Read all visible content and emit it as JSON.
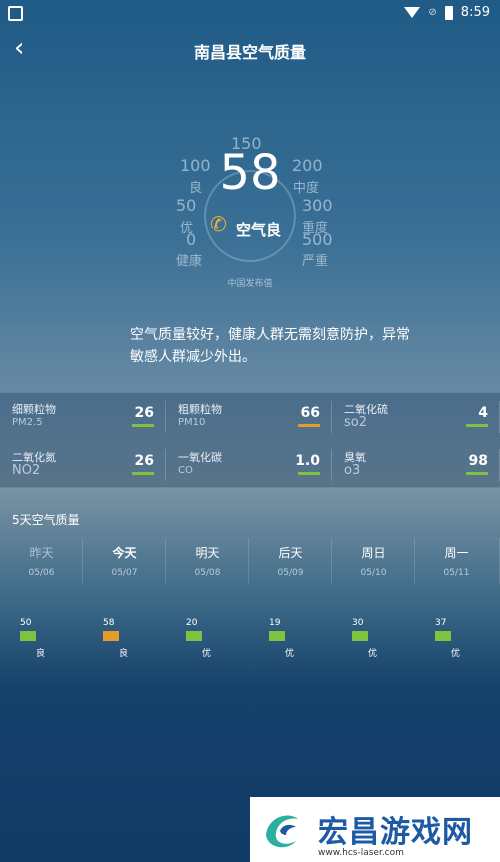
{
  "status_bar": {
    "time": "8:59"
  },
  "header": {
    "title": "南昌县空气质量",
    "back_icon": "chevron-left-icon"
  },
  "gauge": {
    "aqi": "58",
    "level": "空气良",
    "publisher": "中国发布值",
    "ticks": [
      {
        "value": "150",
        "label": ""
      },
      {
        "value": "100",
        "label": "良"
      },
      {
        "value": "200",
        "label": "中度"
      },
      {
        "value": "50",
        "label": "优"
      },
      {
        "value": "300",
        "label": "重度"
      },
      {
        "value": "0",
        "label": "健康"
      },
      {
        "value": "500",
        "label": "严重"
      }
    ]
  },
  "description": "空气质量较好，健康人群无需刻意防护，异常敏感人群减少外出。",
  "pollutants": [
    {
      "name": "细颗粒物",
      "code": "PM2.5",
      "value": "26",
      "color": "#7fc241"
    },
    {
      "name": "粗颗粒物",
      "code": "PM10",
      "value": "66",
      "color": "#e79a2c"
    },
    {
      "name": "二氧化硫",
      "code": "so2",
      "value": "4",
      "color": "#7fc241"
    },
    {
      "name": "二氧化氮",
      "code": "NO2",
      "value": "26",
      "color": "#7fc241"
    },
    {
      "name": "一氧化碳",
      "code": "CO",
      "value": "1.0",
      "color": "#7fc241"
    },
    {
      "name": "臭氧",
      "code": "o3",
      "value": "98",
      "color": "#7fc241"
    }
  ],
  "forecast": {
    "title": "5天空气质量",
    "days": [
      {
        "name": "昨天",
        "date": "05/06",
        "aqi": "50",
        "level": "良",
        "color": "#7fc241"
      },
      {
        "name": "今天",
        "date": "05/07",
        "aqi": "58",
        "level": "良",
        "color": "#e79a2c"
      },
      {
        "name": "明天",
        "date": "05/08",
        "aqi": "20",
        "level": "优",
        "color": "#7fc241"
      },
      {
        "name": "后天",
        "date": "05/09",
        "aqi": "19",
        "level": "优",
        "color": "#7fc241"
      },
      {
        "name": "周日",
        "date": "05/10",
        "aqi": "30",
        "level": "优",
        "color": "#7fc241"
      },
      {
        "name": "周一",
        "date": "05/11",
        "aqi": "37",
        "level": "优",
        "color": "#7fc241"
      }
    ]
  },
  "watermark": {
    "text": "宏昌游戏网",
    "url": "www.hcs-laser.com"
  }
}
